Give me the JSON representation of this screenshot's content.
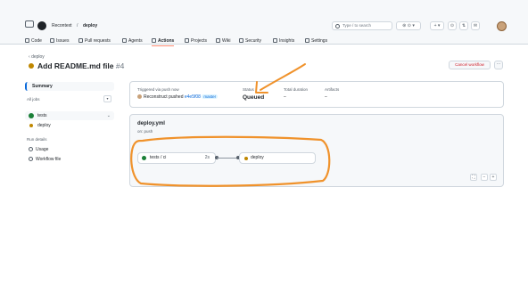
{
  "header": {
    "owner": "Recontext",
    "separator": "/",
    "repo": "deploy",
    "search_placeholder": "Type / to search",
    "copilot_label": "⊛ ⊙ ▾",
    "add_label": "+ ▾",
    "issues_icon": "⊙",
    "pulls_icon": "⇅",
    "inbox_icon": "✉"
  },
  "tabs": [
    {
      "label": "Code",
      "icon": "code-icon"
    },
    {
      "label": "Issues",
      "icon": "issues-icon"
    },
    {
      "label": "Pull requests",
      "icon": "pull-request-icon"
    },
    {
      "label": "Agents",
      "icon": "agents-icon"
    },
    {
      "label": "Actions",
      "icon": "actions-icon",
      "active": true
    },
    {
      "label": "Projects",
      "icon": "projects-icon"
    },
    {
      "label": "Wiki",
      "icon": "wiki-icon"
    },
    {
      "label": "Security",
      "icon": "security-icon"
    },
    {
      "label": "Insights",
      "icon": "insights-icon"
    },
    {
      "label": "Settings",
      "icon": "settings-icon"
    }
  ],
  "run": {
    "back_label": "deploy",
    "title": "Add README.md file",
    "number": "#4",
    "cancel_label": "Cancel workflow",
    "more_label": "···"
  },
  "sidebar": {
    "summary_label": "Summary",
    "all_jobs_label": "All jobs",
    "jobs": [
      {
        "name": "tests",
        "status": "success"
      },
      {
        "name": "deploy",
        "status": "queued"
      }
    ],
    "run_details_label": "Run details",
    "links": [
      {
        "label": "Usage",
        "icon": "clock-icon"
      },
      {
        "label": "Workflow file",
        "icon": "file-icon"
      }
    ]
  },
  "summary": {
    "trigger_label": "Triggered via push now",
    "trigger_text": "Reconstruct pushed",
    "sha": "e4e5f08",
    "branch": "master",
    "status_label": "Status",
    "status_value": "Queued",
    "duration_label": "Total duration",
    "duration_value": "–",
    "artifacts_label": "Artifacts",
    "artifacts_value": "–"
  },
  "workflow": {
    "file": "deploy.yml",
    "trigger": "on: push",
    "jobs": [
      {
        "name": "tests / ci",
        "duration": "2s",
        "status": "success"
      },
      {
        "name": "deploy",
        "duration": "",
        "status": "queued"
      }
    ],
    "zoom_fit": "⛶",
    "zoom_out": "−",
    "zoom_in": "+"
  },
  "colors": {
    "accent": "#0969da",
    "success": "#1a7f37",
    "queued": "#bf8700",
    "danger": "#cf222e",
    "annotation": "#f0922b"
  }
}
